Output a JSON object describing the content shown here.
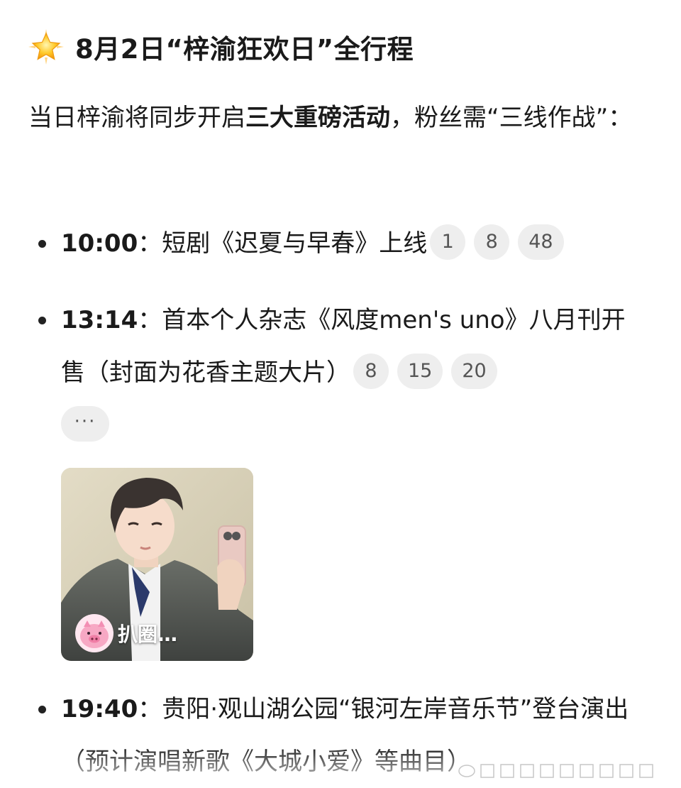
{
  "heading": {
    "icon": "star-icon",
    "text": "8月2日“梓渝狂欢日”全行程"
  },
  "intro": {
    "before": "当日梓渝将同步开启",
    "bold": "三大重磅活动",
    "after": "，粉丝需“三线作战”："
  },
  "items": [
    {
      "time": "10:00",
      "text": "：短剧《迟夏与早春》上线",
      "pills": [
        "1",
        "8",
        "48"
      ]
    },
    {
      "time": "13:14",
      "text": "：首本个人杂志《风度men's uno》八月刊开售（封面为花香主题大片）",
      "pills": [
        "8",
        "15",
        "20"
      ],
      "more": "···"
    },
    {
      "time": "19:40",
      "text": "：贵阳·观山湖公园“银河左岸音乐节”登台演出（预计演唱新歌《大城小爱》等曲目）"
    }
  ],
  "photo_card": {
    "circle_name": "扒圈…"
  },
  "colors": {
    "pill_bg": "#eeeeee",
    "text": "#1a1a1a"
  }
}
